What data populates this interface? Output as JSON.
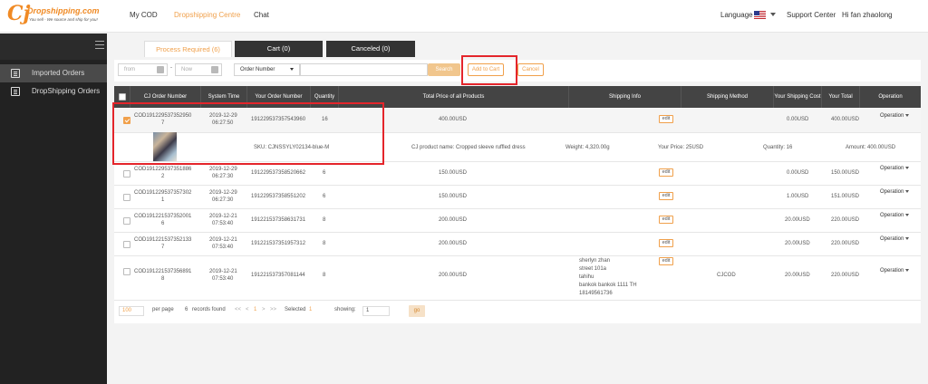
{
  "logo": {
    "name": "Dropshipping.com",
    "slogan": "You sell - We source and ship for you!"
  },
  "nav": {
    "items": [
      "My COD",
      "Dropshipping Centre",
      "Chat"
    ],
    "active": "Dropshipping Centre"
  },
  "header_right": {
    "language": "Language",
    "support": "Support Center",
    "greeting": "Hi fan zhaolong"
  },
  "sidebar": {
    "items": [
      {
        "label": "Imported Orders",
        "active": true
      },
      {
        "label": "DropShipping Orders",
        "active": false
      }
    ]
  },
  "tabs": [
    {
      "label": "Process Required (6)"
    },
    {
      "label": "Cart (0)"
    },
    {
      "label": "Canceled (0)"
    }
  ],
  "filters": {
    "from_placeholder": "from",
    "now_placeholder": "Now",
    "dash": "-",
    "field_select": "Order Number",
    "search_label": "Search",
    "add_to_cart_label": "Add to Cart",
    "cancel_label": "Cancel"
  },
  "table": {
    "headers": [
      "CJ Order Number",
      "System Time",
      "Your Order Number",
      "Quantity",
      "Total Price of all Products",
      "Shipping Info",
      "Shipping Method",
      "Your Shipping Cost",
      "Your Total",
      "Operation"
    ],
    "edit_label": "edit",
    "operation_label": "Operation",
    "rows": [
      {
        "cj": [
          "COD191229537352950",
          "7"
        ],
        "time": [
          "2019-12-29",
          "06:27:50"
        ],
        "your": "191229537357543960",
        "qty": "16",
        "price": "400.00USD",
        "ship_info": [],
        "method": "",
        "ship_cost": "0.00USD",
        "total": "400.00USD",
        "checked": true
      },
      {
        "cj": [
          "COD191229537351886",
          "2"
        ],
        "time": [
          "2019-12-29",
          "06:27:30"
        ],
        "your": "191229537358520662",
        "qty": "6",
        "price": "150.00USD",
        "ship_info": [],
        "method": "",
        "ship_cost": "0.00USD",
        "total": "150.00USD",
        "checked": false
      },
      {
        "cj": [
          "COD191229537357302",
          "1"
        ],
        "time": [
          "2019-12-29",
          "06:27:30"
        ],
        "your": "191229537358551202",
        "qty": "6",
        "price": "150.00USD",
        "ship_info": [],
        "method": "",
        "ship_cost": "1.00USD",
        "total": "151.00USD",
        "checked": false
      },
      {
        "cj": [
          "COD191221537352001",
          "6"
        ],
        "time": [
          "2019-12-21",
          "07:53:40"
        ],
        "your": "191221537358631731",
        "qty": "8",
        "price": "200.00USD",
        "ship_info": [],
        "method": "",
        "ship_cost": "20.00USD",
        "total": "220.00USD",
        "checked": false
      },
      {
        "cj": [
          "COD191221537352133",
          "7"
        ],
        "time": [
          "2019-12-21",
          "07:53:40"
        ],
        "your": "191221537351957312",
        "qty": "8",
        "price": "200.00USD",
        "ship_info": [],
        "method": "",
        "ship_cost": "20.00USD",
        "total": "220.00USD",
        "checked": false
      },
      {
        "cj": [
          "COD191221537356891",
          "8"
        ],
        "time": [
          "2019-12-21",
          "07:53:40"
        ],
        "your": "191221537357081144",
        "qty": "8",
        "price": "200.00USD",
        "ship_info": [
          "sherlyn zhan",
          "street 101a",
          "tahihu",
          "bankok bankok 1111 TH",
          "18149561736"
        ],
        "method": "CJCOD",
        "ship_cost": "20.00USD",
        "total": "220.00USD",
        "checked": false
      }
    ],
    "detail": {
      "sku": "SKU: CJNSSYLY02134-blue-M",
      "product": "CJ product name: Cropped sleeve ruffled dress",
      "weight": "Weight: 4,320.00g",
      "your_price": "Your Price: 25USD",
      "quantity": "Quantity: 16",
      "amount": "Amount: 400.00USD"
    }
  },
  "pager": {
    "per_page_value": "100",
    "per_page_label": "per page",
    "count": "6",
    "records_label": "records found",
    "first": "<<",
    "prev": "<",
    "page": "1",
    "next": ">",
    "last": ">>",
    "selected_label": "Selected",
    "selected_count": "1",
    "showing_label": "showing:",
    "showing_value": "1",
    "go_label": "go"
  },
  "colors": {
    "accent": "#f0a04b",
    "highlight": "#e4252b",
    "header_bg": "#444444",
    "sidebar_bg": "#222222"
  }
}
